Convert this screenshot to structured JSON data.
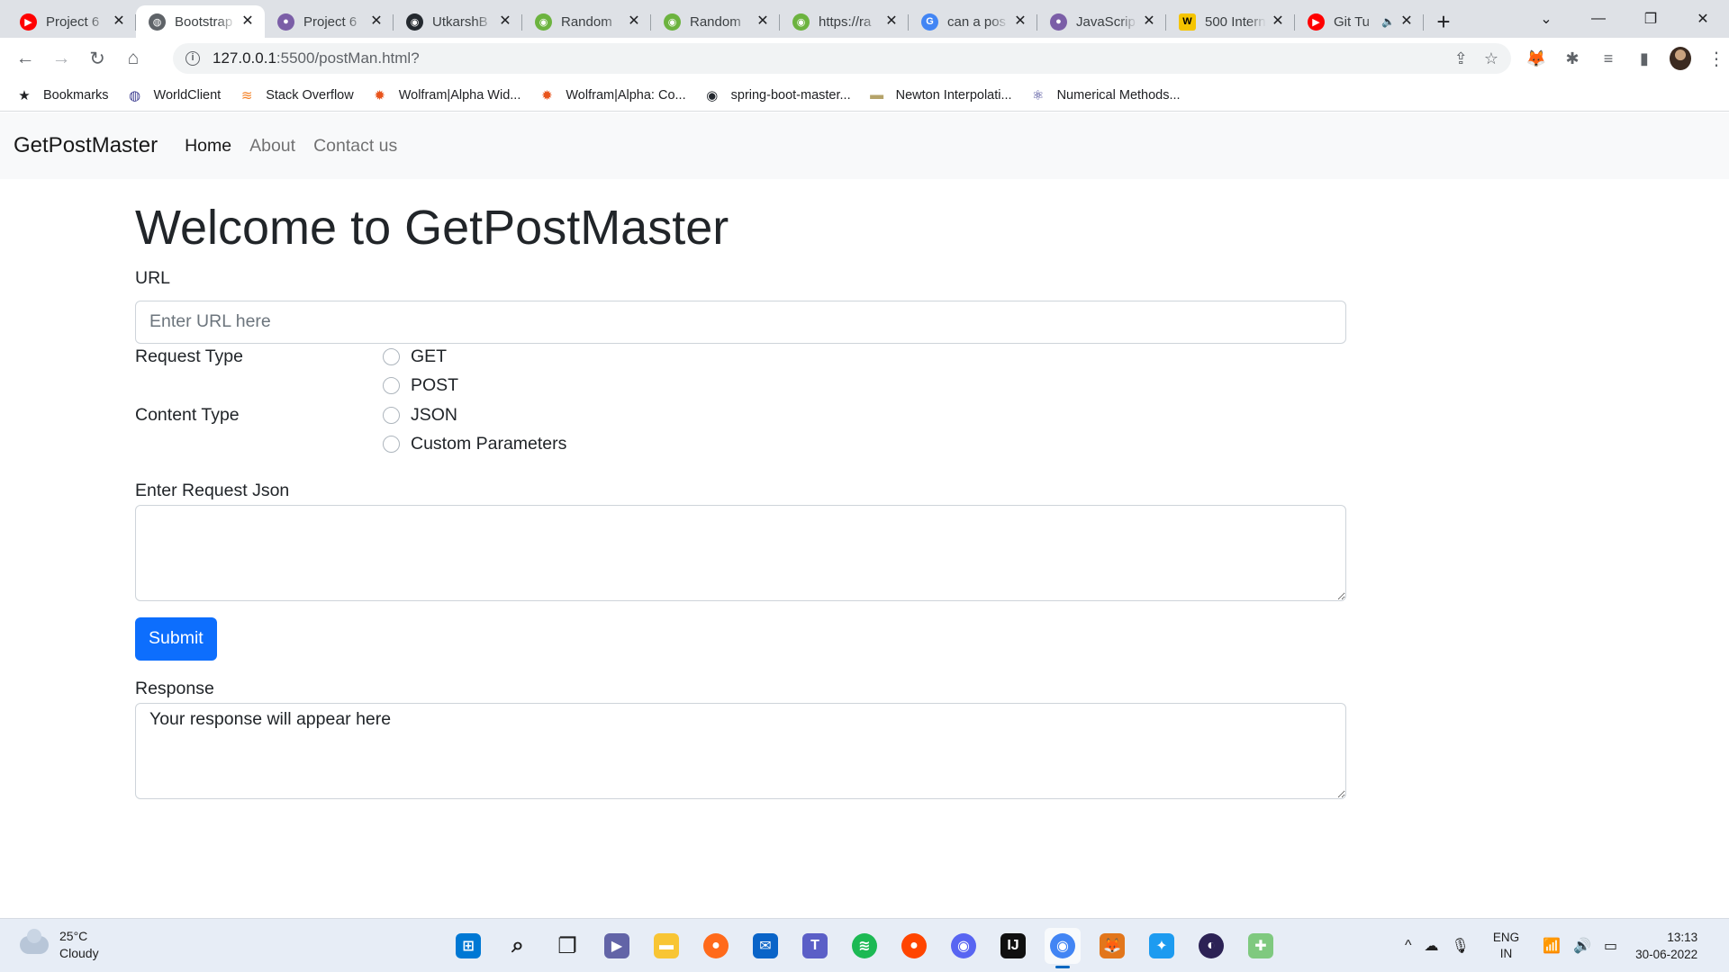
{
  "browser": {
    "tabs": [
      {
        "title": "Project 6",
        "favicon": "youtube-icon",
        "color": "#ff0000",
        "glyph": "▶"
      },
      {
        "title": "Bootstrap",
        "favicon": "globe-icon",
        "color": "#5f6368",
        "glyph": "◍",
        "active": true
      },
      {
        "title": "Project 6",
        "favicon": "avatar-icon",
        "color": "#7b5ea7",
        "glyph": "●"
      },
      {
        "title": "UtkarshB",
        "favicon": "github-icon",
        "color": "#24292f",
        "glyph": "◉"
      },
      {
        "title": "Random",
        "favicon": "api-icon",
        "color": "#6cb33f",
        "glyph": "◉"
      },
      {
        "title": "Random",
        "favicon": "api-icon",
        "color": "#6cb33f",
        "glyph": "◉"
      },
      {
        "title": "https://ra",
        "favicon": "api-icon",
        "color": "#6cb33f",
        "glyph": "◉"
      },
      {
        "title": "can a pos",
        "favicon": "google-icon",
        "color": "#4285f4",
        "glyph": "G"
      },
      {
        "title": "JavaScrip",
        "favicon": "avatar-icon",
        "color": "#7b5ea7",
        "glyph": "●"
      },
      {
        "title": "500 Intern",
        "favicon": "w-icon",
        "color": "#f5c400",
        "glyph": "W"
      },
      {
        "title": "Git Tu",
        "favicon": "youtube-icon",
        "color": "#ff0000",
        "glyph": "▶",
        "audio": "🔈"
      }
    ],
    "new_tab": "+",
    "window_controls": {
      "tab_search": "⌄",
      "minimize": "—",
      "maximize": "❐",
      "close": "✕"
    },
    "nav": {
      "back": "←",
      "forward": "→",
      "reload": "↻",
      "home": "⌂"
    },
    "url": {
      "host": "127.0.0.1",
      "rest": ":5500/postMan.html?",
      "info": "i"
    },
    "omnibox_icons": {
      "share": "⇪",
      "star": "☆"
    },
    "extensions": {
      "metamask": "🦊",
      "puzzle": "✱",
      "media": "≡",
      "sidepanel": "▮"
    },
    "bookmarks": [
      {
        "label": "Bookmarks",
        "icon": "star-icon",
        "glyph": "★",
        "color": "#202124"
      },
      {
        "label": "WorldClient",
        "icon": "globe-icon",
        "glyph": "◍",
        "color": "#3b3b8f"
      },
      {
        "label": "Stack Overflow",
        "icon": "stackoverflow-icon",
        "glyph": "≋",
        "color": "#f48024"
      },
      {
        "label": "Wolfram|Alpha Wid...",
        "icon": "wolfram-icon",
        "glyph": "✹",
        "color": "#e8541c"
      },
      {
        "label": "Wolfram|Alpha: Co...",
        "icon": "wolfram-icon",
        "glyph": "✹",
        "color": "#e8541c"
      },
      {
        "label": "spring-boot-master...",
        "icon": "github-icon",
        "glyph": "◉",
        "color": "#24292f"
      },
      {
        "label": "Newton Interpolati...",
        "icon": "file-icon",
        "glyph": "▬",
        "color": "#b5a36a"
      },
      {
        "label": "Numerical Methods...",
        "icon": "atom-icon",
        "glyph": "⚛",
        "color": "#3b3b8f"
      }
    ]
  },
  "page": {
    "brand": "GetPostMaster",
    "nav": {
      "home": "Home",
      "about": "About",
      "contact": "Contact us"
    },
    "heading": "Welcome to GetPostMaster",
    "url_label": "URL",
    "url_placeholder": "Enter URL here",
    "request_type_label": "Request Type",
    "request_types": [
      "GET",
      "POST"
    ],
    "content_type_label": "Content Type",
    "content_types": [
      "JSON",
      "Custom Parameters"
    ],
    "json_label": "Enter Request Json",
    "submit": "Submit",
    "response_label": "Response",
    "response_placeholder": "Your response will appear here"
  },
  "taskbar": {
    "weather": {
      "temp": "25°C",
      "desc": "Cloudy"
    },
    "apps": [
      {
        "name": "windows-start-icon",
        "color": "#0078d4",
        "glyph": "⊞"
      },
      {
        "name": "search-icon",
        "color": "#202020",
        "glyph": "⌕"
      },
      {
        "name": "task-view-icon",
        "color": "#202020",
        "glyph": "❐"
      },
      {
        "name": "chat-icon",
        "color": "#6264a7",
        "glyph": "▶"
      },
      {
        "name": "file-explorer-icon",
        "color": "#f8c534",
        "glyph": "▬"
      },
      {
        "name": "firefox-icon",
        "color": "#ff6a1b",
        "glyph": "●"
      },
      {
        "name": "mail-icon",
        "color": "#0a64c8",
        "glyph": "✉"
      },
      {
        "name": "teams-icon",
        "color": "#5b5fc7",
        "glyph": "T"
      },
      {
        "name": "spotify-icon",
        "color": "#1db954",
        "glyph": "≋"
      },
      {
        "name": "reddit-icon",
        "color": "#ff4500",
        "glyph": "●"
      },
      {
        "name": "discord-icon",
        "color": "#5865f2",
        "glyph": "◉"
      },
      {
        "name": "intellij-icon",
        "color": "#101010",
        "glyph": "IJ"
      },
      {
        "name": "chrome-icon",
        "color": "#4285f4",
        "glyph": "◉",
        "active": true
      },
      {
        "name": "metamask-icon",
        "color": "#e2761b",
        "glyph": "🦊"
      },
      {
        "name": "twitter-icon",
        "color": "#1d9bf0",
        "glyph": "✦"
      },
      {
        "name": "eclipse-icon",
        "color": "#2c2255",
        "glyph": "◐"
      },
      {
        "name": "git-kraken-icon",
        "color": "#7fc97f",
        "glyph": "✚"
      }
    ],
    "tray": {
      "chevron": "^",
      "onedrive": "☁",
      "mic": "🎙",
      "wifi": "📶",
      "volume": "🔊",
      "battery": "▭"
    },
    "lang": [
      "ENG",
      "IN"
    ],
    "time": "13:13",
    "date": "30-06-2022"
  }
}
